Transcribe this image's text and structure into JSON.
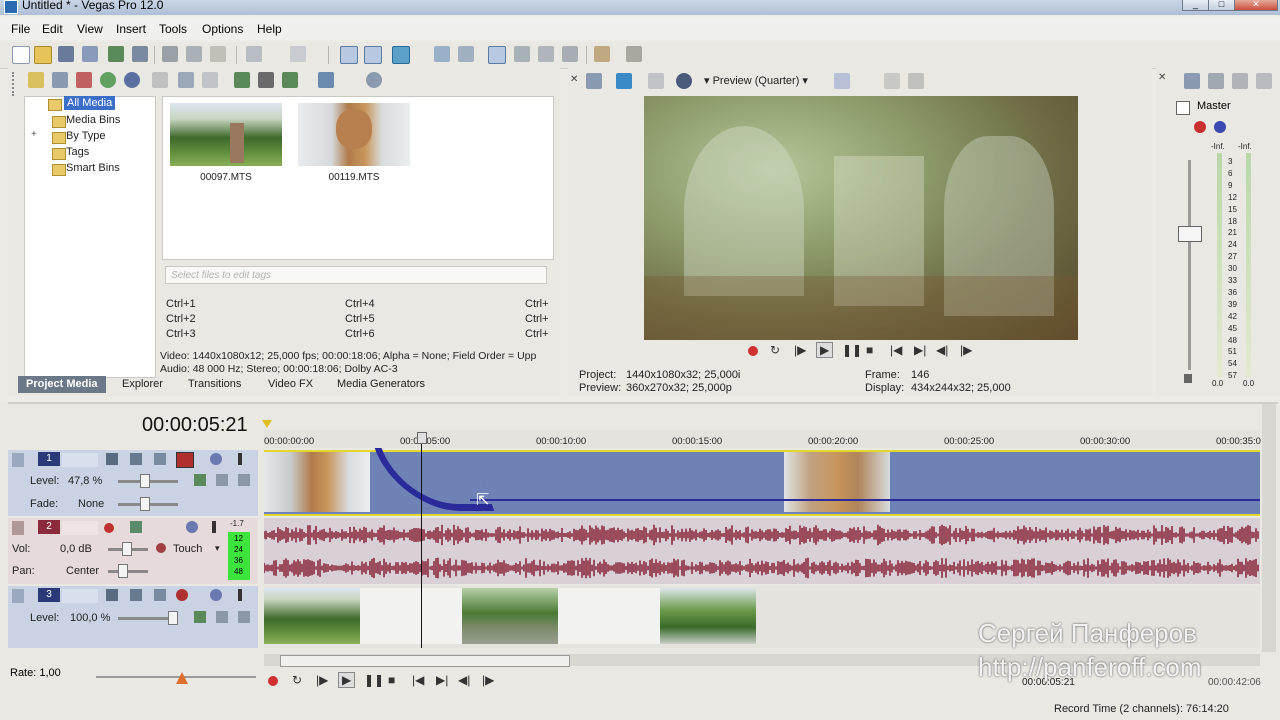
{
  "window": {
    "title": "Untitled * - Vegas Pro 12.0"
  },
  "menu": [
    "File",
    "Edit",
    "View",
    "Insert",
    "Tools",
    "Options",
    "Help"
  ],
  "explorer": {
    "tree": [
      "All Media",
      "Media Bins",
      "By Type",
      "Tags",
      "Smart Bins"
    ],
    "tree_expander": "+",
    "media": [
      {
        "name": "00097.MTS"
      },
      {
        "name": "00119.MTS"
      }
    ],
    "tags_placeholder": "Select files to edit tags",
    "shortcuts": [
      [
        "Ctrl+1",
        "Ctrl+4",
        "Ctrl+"
      ],
      [
        "Ctrl+2",
        "Ctrl+5",
        "Ctrl+"
      ],
      [
        "Ctrl+3",
        "Ctrl+6",
        "Ctrl+"
      ]
    ],
    "info_video": "Video: 1440x1080x12; 25,000 fps; 00:00:18:06; Alpha = None; Field Order = Upp",
    "info_audio": "Audio: 48 000 Hz; Stereo; 00:00:18:06; Dolby AC-3",
    "tabs": [
      "Project Media",
      "Explorer",
      "Transitions",
      "Video FX",
      "Media Generators"
    ]
  },
  "preview": {
    "quality": "Preview (Quarter)",
    "project_label": "Project:",
    "project_value": "1440x1080x32; 25,000i",
    "preview_label": "Preview:",
    "preview_value": "360x270x32; 25,000p",
    "frame_label": "Frame:",
    "frame_value": "146",
    "display_label": "Display:",
    "display_value": "434x244x32; 25,000"
  },
  "master": {
    "title": "Master",
    "inf_left": "-Inf.",
    "inf_right": "-Inf.",
    "scale": [
      "3",
      "6",
      "9",
      "12",
      "15",
      "18",
      "21",
      "24",
      "27",
      "30",
      "33",
      "36",
      "39",
      "42",
      "45",
      "48",
      "51",
      "54",
      "57"
    ],
    "bottom_left": "0.0",
    "bottom_right": "0.0"
  },
  "timeline": {
    "timecode": "00:00:05:21",
    "ruler": [
      "00:00:00:00",
      "00:00:05:00",
      "00:00:10:00",
      "00:00:15:00",
      "00:00:20:00",
      "00:00:25:00",
      "00:00:30:00",
      "00:00:35:0"
    ],
    "tracks": [
      {
        "num": "1",
        "type": "video",
        "level_label": "Level:",
        "level_value": "47,8 %",
        "fade_label": "Fade:",
        "fade_value": "None"
      },
      {
        "num": "2",
        "type": "audio",
        "vol_label": "Vol:",
        "vol_value": "0,0 dB",
        "mode": "Touch",
        "pan_label": "Pan:",
        "pan_value": "Center",
        "peak": "-1.7",
        "meter_ticks": [
          "12",
          "24",
          "36",
          "48"
        ]
      },
      {
        "num": "3",
        "type": "video",
        "level_label": "Level:",
        "level_value": "100,0 %"
      }
    ],
    "rate": "Rate: 1,00",
    "end_time": "00:00:05:21",
    "end_time2": "00:00:42:06",
    "record_time": "Record Time (2 channels): 76:14:20"
  },
  "watermark": {
    "name": "Сергей Панферов",
    "url": "http://panferoff.com"
  },
  "colors": {
    "video_track": "#6e82b5",
    "audio_track": "#d9cfd6",
    "waveform": "#8a2a3e",
    "envelope": "#2b2a9a",
    "header_active": "#6b7887"
  }
}
